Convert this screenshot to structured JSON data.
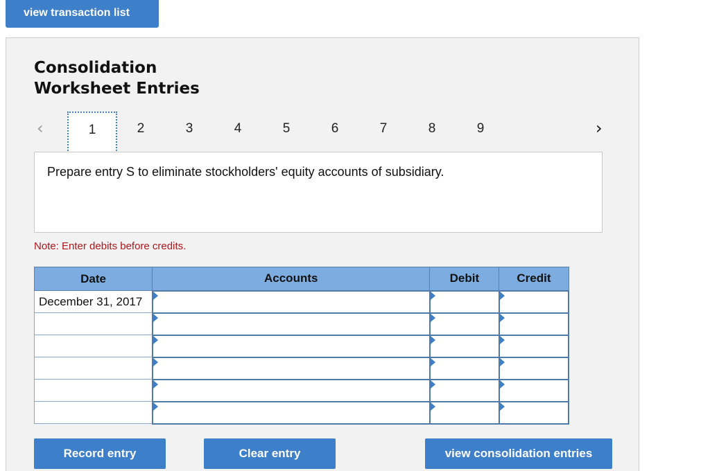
{
  "top_button": {
    "label": "view transaction list"
  },
  "title": {
    "line1": "Consolidation",
    "line2": "Worksheet Entries"
  },
  "pager": {
    "pages": [
      "1",
      "2",
      "3",
      "4",
      "5",
      "6",
      "7",
      "8",
      "9"
    ],
    "active": "1"
  },
  "prompt": "Prepare entry S to eliminate stockholders' equity accounts of subsidiary.",
  "note": "Note: Enter debits before credits.",
  "table": {
    "headers": {
      "date": "Date",
      "accounts": "Accounts",
      "debit": "Debit",
      "credit": "Credit"
    },
    "rows": [
      {
        "date": "December 31, 2017",
        "accounts": "",
        "debit": "",
        "credit": ""
      },
      {
        "date": "",
        "accounts": "",
        "debit": "",
        "credit": ""
      },
      {
        "date": "",
        "accounts": "",
        "debit": "",
        "credit": ""
      },
      {
        "date": "",
        "accounts": "",
        "debit": "",
        "credit": ""
      },
      {
        "date": "",
        "accounts": "",
        "debit": "",
        "credit": ""
      },
      {
        "date": "",
        "accounts": "",
        "debit": "",
        "credit": ""
      }
    ]
  },
  "buttons": {
    "record": "Record entry",
    "clear": "Clear entry",
    "view": "view consolidation entries"
  },
  "colors": {
    "accent": "#3d7fc9",
    "header": "#7dade0",
    "note": "#b0151a",
    "panel": "#f2f2f2"
  }
}
